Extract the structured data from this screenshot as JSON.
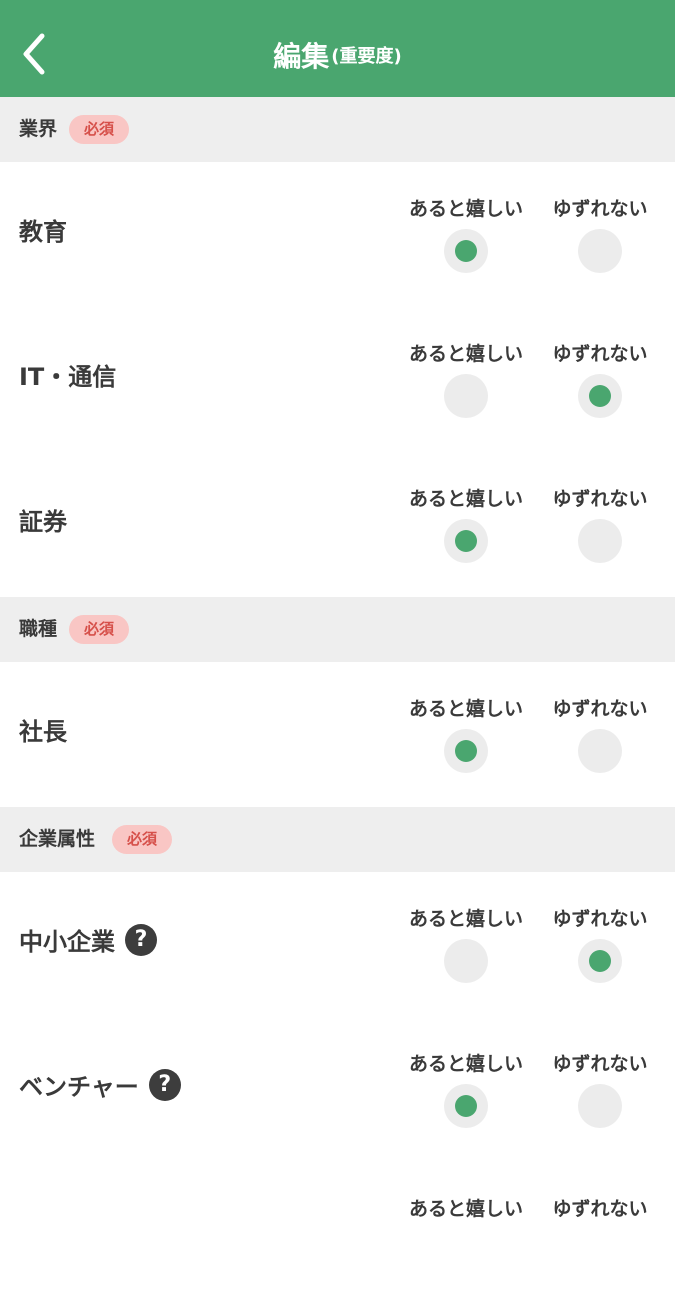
{
  "header": {
    "title": "編集",
    "subtitle": "(重要度)",
    "back_icon": "chevron-left-icon"
  },
  "colors": {
    "accent": "#4aa66f",
    "section_bg": "#eeeeee",
    "badge_bg": "#f9c6c4",
    "badge_text": "#d6504a",
    "radio_bg": "#ececec"
  },
  "options": {
    "nice_to_have": "あると嬉しい",
    "must_have": "ゆずれない"
  },
  "sections": [
    {
      "title": "業界",
      "badge": "必須",
      "items": [
        {
          "label": "教育",
          "selected": "nice_to_have",
          "help": false
        },
        {
          "label": "IT・通信",
          "selected": "must_have",
          "help": false
        },
        {
          "label": "証券",
          "selected": "nice_to_have",
          "help": false
        }
      ]
    },
    {
      "title": "職種",
      "badge": "必須",
      "items": [
        {
          "label": "社長",
          "selected": "nice_to_have",
          "help": false
        }
      ]
    },
    {
      "title": "企業属性",
      "badge": "必須",
      "items": [
        {
          "label": "中小企業",
          "selected": "must_have",
          "help": true,
          "help_icon_text": "?"
        },
        {
          "label": "ベンチャー",
          "selected": "nice_to_have",
          "help": true,
          "help_icon_text": "?"
        }
      ]
    }
  ]
}
